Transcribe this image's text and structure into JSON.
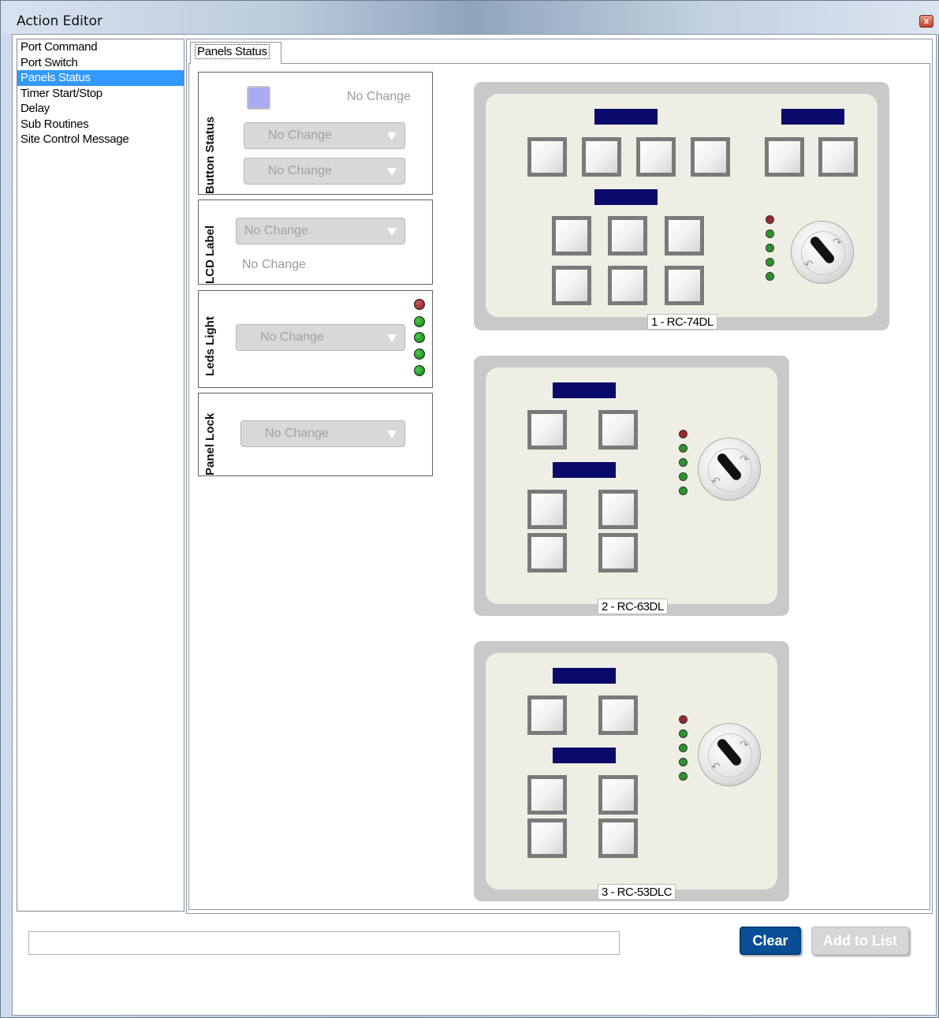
{
  "window": {
    "title": "Action Editor",
    "close_label": "x"
  },
  "actions": [
    {
      "label": "Port Command"
    },
    {
      "label": "Port Switch"
    },
    {
      "label": "Panels Status",
      "selected": true
    },
    {
      "label": "Timer Start/Stop"
    },
    {
      "label": "Delay"
    },
    {
      "label": "Sub Routines"
    },
    {
      "label": "Site Control Message"
    }
  ],
  "tab": {
    "label": "Panels Status"
  },
  "button_status": {
    "title": "Button Status",
    "swatch_color": "#aaaaf2",
    "swatch_text": "No Change",
    "dropdown1": "No Change",
    "dropdown2": "No Change"
  },
  "lcd_label": {
    "title": "LCD Label",
    "dropdown": "No Change",
    "text": "No Change"
  },
  "leds_light": {
    "title": "Leds Light",
    "dropdown": "No Change",
    "leds": [
      "red",
      "green",
      "green",
      "green",
      "green"
    ]
  },
  "panel_lock": {
    "title": "Panel Lock",
    "dropdown": "No Change"
  },
  "panels": [
    {
      "label": "1 - RC-74DL"
    },
    {
      "label": "2 - RC-63DL"
    },
    {
      "label": "3 - RC-53DLC"
    }
  ],
  "bottom": {
    "text_value": "",
    "clear_label": "Clear",
    "add_label": "Add to List"
  },
  "colors": {
    "selection": "#3399ff",
    "lcd": "#0a0a6a",
    "clear_button": "#0a4f95",
    "led_red": "#9a2a2a",
    "led_green": "#2a952a"
  }
}
